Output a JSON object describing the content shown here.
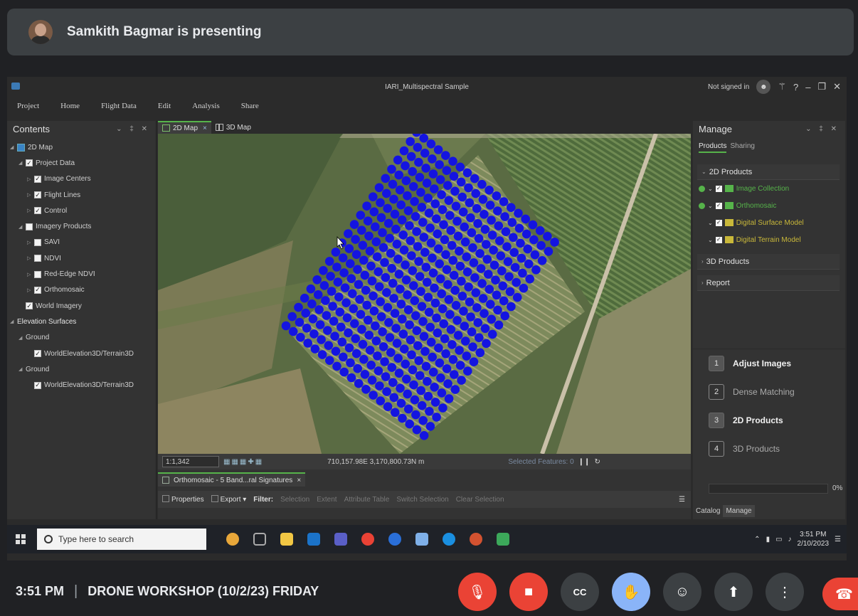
{
  "meet": {
    "presenter_text": "Samkith Bagmar is presenting",
    "time": "3:51 PM",
    "separator": "|",
    "meeting_title": "DRONE WORKSHOP (10/2/23) FRIDAY",
    "controls": [
      "mic-off-icon",
      "camera-off-icon",
      "captions-icon",
      "raise-hand-icon",
      "emoji-icon",
      "present-icon",
      "more-options-icon",
      "leave-call-icon"
    ],
    "captions_label": "CC"
  },
  "app": {
    "window_title": "IARI_Multispectral Sample",
    "signin_text": "Not signed in",
    "help": "?",
    "menu": [
      "Project",
      "Home",
      "Flight Data",
      "Edit",
      "Analysis",
      "Share"
    ]
  },
  "contents": {
    "title": "Contents",
    "tree": [
      {
        "label": "2D Map",
        "level": 0,
        "toggle": "◢",
        "type": "map"
      },
      {
        "label": "Project Data",
        "level": 1,
        "toggle": "◢",
        "checked": true
      },
      {
        "label": "Image Centers",
        "level": 2,
        "toggle": "▷",
        "checked": true
      },
      {
        "label": "Flight Lines",
        "level": 2,
        "toggle": "▷",
        "checked": true
      },
      {
        "label": "Control",
        "level": 2,
        "toggle": "▷",
        "checked": true
      },
      {
        "label": "Imagery Products",
        "level": 1,
        "toggle": "◢",
        "checked": false
      },
      {
        "label": "SAVI",
        "level": 2,
        "toggle": "▷",
        "checked": false
      },
      {
        "label": "NDVI",
        "level": 2,
        "toggle": "▷",
        "checked": false
      },
      {
        "label": "Red-Edge NDVI",
        "level": 2,
        "toggle": "▷",
        "checked": false
      },
      {
        "label": "Orthomosaic",
        "level": 2,
        "toggle": "▷",
        "checked": true
      },
      {
        "label": "World Imagery",
        "level": 1,
        "toggle": "",
        "checked": true
      },
      {
        "label": "Elevation Surfaces",
        "level": 0,
        "toggle": "◢",
        "bold": true
      },
      {
        "label": "Ground",
        "level": 1,
        "toggle": "◢"
      },
      {
        "label": "WorldElevation3D/Terrain3D",
        "level": 2,
        "toggle": "",
        "checked": true
      },
      {
        "label": "Ground",
        "level": 1,
        "toggle": "◢"
      },
      {
        "label": "WorldElevation3D/Terrain3D",
        "level": 2,
        "toggle": "",
        "checked": true
      }
    ]
  },
  "map": {
    "tabs": [
      {
        "label": "2D Map",
        "active": true,
        "close": "×"
      },
      {
        "label": "3D Map",
        "active": false
      }
    ],
    "scale": "1:1,342",
    "coordinates": "710,157.98E 3,170,800.73N m",
    "selected_features": "Selected Features: 0",
    "points_color": "#1414e0"
  },
  "attribute_table": {
    "tab_label": "Orthomosaic - 5 Band...ral Signatures",
    "close": "×",
    "tools": {
      "properties": "Properties",
      "export": "Export",
      "filter": "Filter:",
      "selection": "Selection",
      "extent": "Extent",
      "attribute_table": "Attribute Table",
      "switch_selection": "Switch Selection",
      "clear_selection": "Clear Selection"
    }
  },
  "manage": {
    "title": "Manage",
    "subtabs": [
      "Products",
      "Sharing"
    ],
    "sections": {
      "2d": "2D Products",
      "3d": "3D Products",
      "report": "Report"
    },
    "products": [
      {
        "label": "Image Collection",
        "status": "ok",
        "color": "#56b34a"
      },
      {
        "label": "Orthomosaic",
        "status": "ok",
        "color": "#56b34a"
      },
      {
        "label": "Digital Surface Model",
        "status": "none",
        "color": "#c9b83a"
      },
      {
        "label": "Digital Terrain Model",
        "status": "none",
        "color": "#c9b83a"
      }
    ],
    "workflow": [
      {
        "num": "1",
        "label": "Adjust Images",
        "active": true
      },
      {
        "num": "2",
        "label": "Dense Matching",
        "active": false
      },
      {
        "num": "3",
        "label": "2D Products",
        "active": true
      },
      {
        "num": "4",
        "label": "3D Products",
        "active": false
      }
    ],
    "progress": 0,
    "progress_label": "0%",
    "bottom_tabs": [
      "Catalog",
      "Manage"
    ]
  },
  "taskbar": {
    "search_placeholder": "Type here to search",
    "clock_time": "3:51 PM",
    "clock_date": "2/10/2023"
  }
}
